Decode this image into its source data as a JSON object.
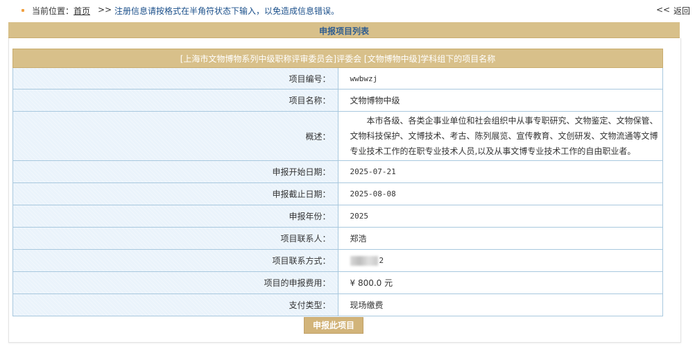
{
  "breadcrumb": {
    "label": "当前位置：",
    "home": "首页",
    "separator": ">>",
    "notice": "注册信息请按格式在半角符状态下输入，以免造成信息错误。",
    "back_arrow": "<<",
    "back": "返回"
  },
  "panel": {
    "title": "申报项目列表"
  },
  "table": {
    "header": "[上海市文物博物系列中级职称评审委员会]评委会 [文物博物中级]学科组下的项目名称",
    "rows": [
      {
        "label": "项目编号：",
        "value": "wwbwzj"
      },
      {
        "label": "项目名称：",
        "value": "文物博物中级"
      },
      {
        "label": "概述：",
        "value": "本市各级、各类企事业单位和社会组织中从事专职研究、文物鉴定、文物保管、文物科技保护、文博技术、考古、陈列展览、宣传教育、文创研发、文物流通等文博专业技术工作的在职专业技术人员,以及从事文博专业技术工作的自由职业者。"
      },
      {
        "label": "申报开始日期：",
        "value": "2025-07-21"
      },
      {
        "label": "申报截止日期：",
        "value": "2025-08-08"
      },
      {
        "label": "申报年份：",
        "value": "2025"
      },
      {
        "label": "项目联系人：",
        "value": "郑浩"
      },
      {
        "label": "项目联系方式：",
        "value": "2"
      },
      {
        "label": "项目的申报费用：",
        "value": "¥  800.0 元"
      },
      {
        "label": "支付类型：",
        "value": "现场缴费"
      }
    ]
  },
  "submit_button": "申报此项目",
  "colors": {
    "accent": "#d8c08a",
    "title_text": "#2f5d90",
    "notice_text": "#1a4f8a",
    "label_bg": "#eaf3fb",
    "border": "#a8c8de"
  }
}
